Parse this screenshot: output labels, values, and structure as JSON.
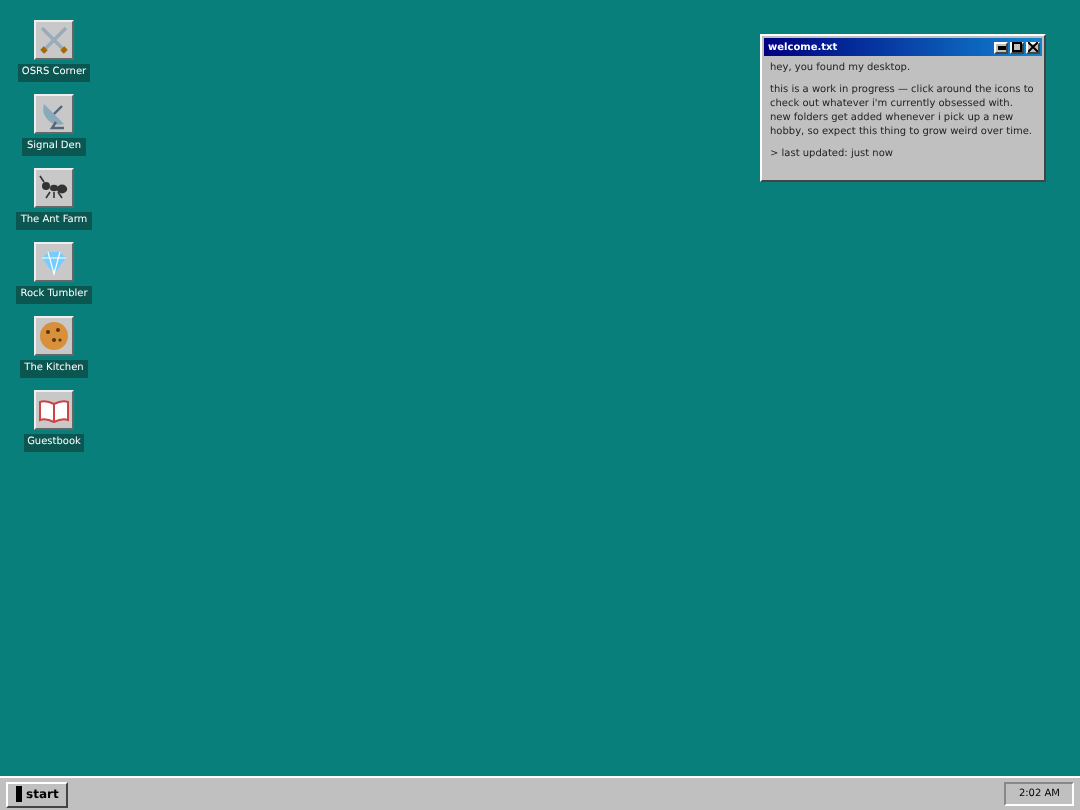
{
  "desktop_icons": [
    {
      "label": "OSRS Corner",
      "kind": "swords"
    },
    {
      "label": "Signal Den",
      "kind": "dish"
    },
    {
      "label": "The Ant Farm",
      "kind": "ant"
    },
    {
      "label": "Rock Tumbler",
      "kind": "gem"
    },
    {
      "label": "The Kitchen",
      "kind": "cookie"
    },
    {
      "label": "Guestbook",
      "kind": "book"
    }
  ],
  "window": {
    "title": "welcome.txt",
    "paragraphs": [
      "hey, you found my desktop.",
      "this is a work in progress — click around the icons to check out whatever i'm currently obsessed with. new folders get added whenever i pick up a new hobby, so expect this thing to grow weird over time.",
      "> last updated: just now"
    ]
  },
  "taskbar": {
    "start_label": "start",
    "clock": "2:02 AM"
  }
}
